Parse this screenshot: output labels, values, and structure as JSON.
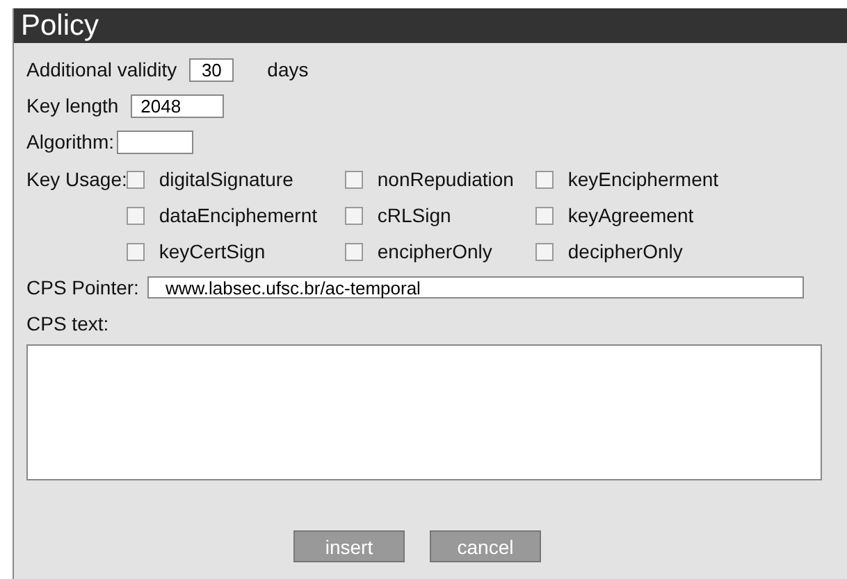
{
  "window": {
    "title": "Policy"
  },
  "validity": {
    "label": "Additional validity",
    "value": "30",
    "unit": "days"
  },
  "key_length": {
    "label": "Key length",
    "value": "2048"
  },
  "algorithm": {
    "label": "Algorithm:"
  },
  "key_usage": {
    "label": "Key Usage:",
    "options": [
      {
        "label": "digitalSignature",
        "checked": false
      },
      {
        "label": "nonRepudiation",
        "checked": false
      },
      {
        "label": "keyEncipherment",
        "checked": false
      },
      {
        "label": "dataEnciphemernt",
        "checked": false
      },
      {
        "label": "cRLSign",
        "checked": false
      },
      {
        "label": "keyAgreement",
        "checked": false
      },
      {
        "label": "keyCertSign",
        "checked": false
      },
      {
        "label": "encipherOnly",
        "checked": false
      },
      {
        "label": "decipherOnly",
        "checked": false
      }
    ]
  },
  "cps_pointer": {
    "label": "CPS Pointer:",
    "value": "www.labsec.ufsc.br/ac-temporal"
  },
  "cps_text": {
    "label": "CPS text:"
  },
  "buttons": [
    "insert",
    "cancel"
  ]
}
